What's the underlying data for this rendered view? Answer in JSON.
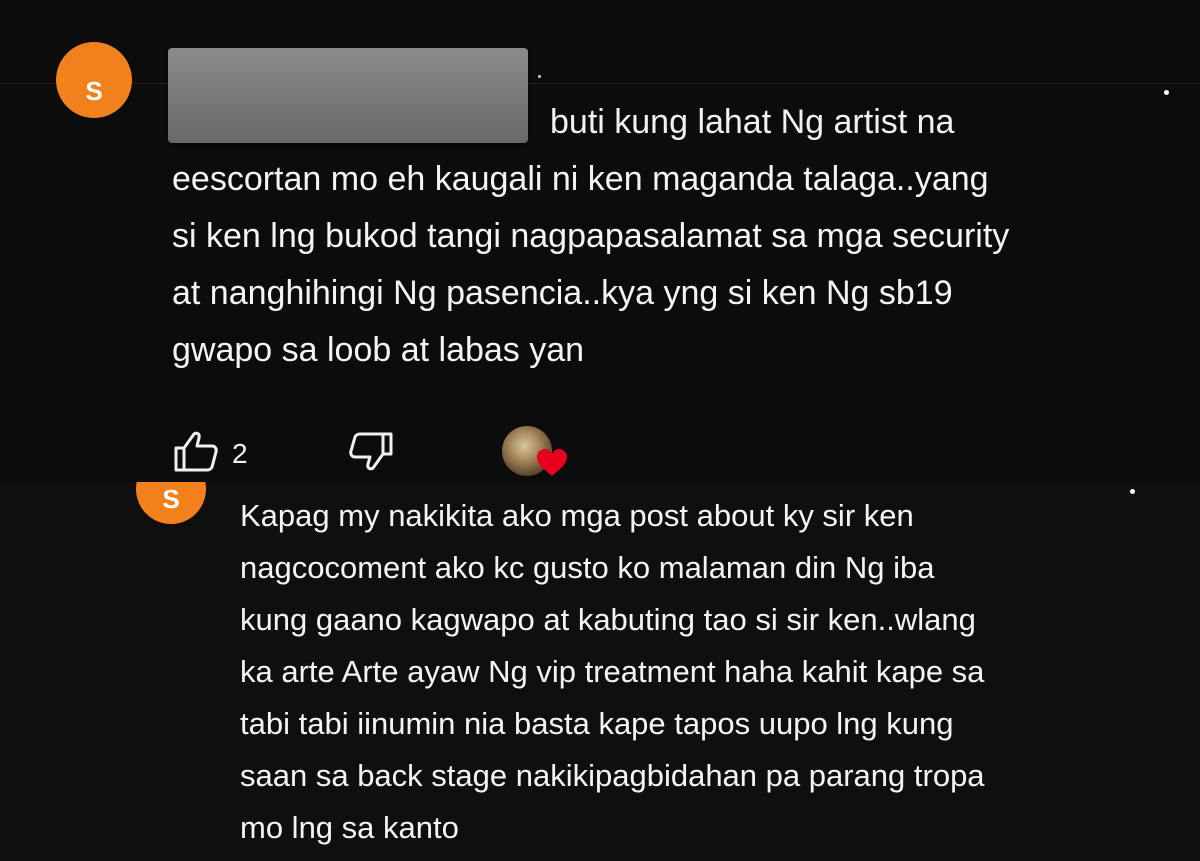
{
  "comment_1": {
    "avatar_initial": "S",
    "text_first_line": "buti kung lahat Ng artist na",
    "text_rest": "eescortan mo eh kaugali ni ken maganda talaga..yang\nsi ken lng bukod tangi nagpapasalamat sa mga security\nat nanghihingi Ng pasencia..kya yng si ken Ng sb19\ngwapo sa loob at labas yan",
    "like_count": "2",
    "icons": {
      "like": "thumbs-up-icon",
      "dislike": "thumbs-down-icon",
      "heart": "heart-icon",
      "more": "more-vert-icon"
    },
    "colors": {
      "avatar": "#f2811d",
      "heart": "#e8001c"
    }
  },
  "comment_2": {
    "avatar_initial": "S",
    "text": "Kapag my nakikita ako mga post about ky sir ken\nnagcocoment ako kc gusto ko malaman din Ng iba\nkung gaano kagwapo at kabuting tao si sir ken..wlang\nka arte Arte ayaw Ng vip treatment haha kahit kape sa\ntabi tabi iinumin nia basta kape tapos uupo lng kung\nsaan sa back stage nakikipagbidahan pa parang tropa\nmo lng sa kanto"
  }
}
